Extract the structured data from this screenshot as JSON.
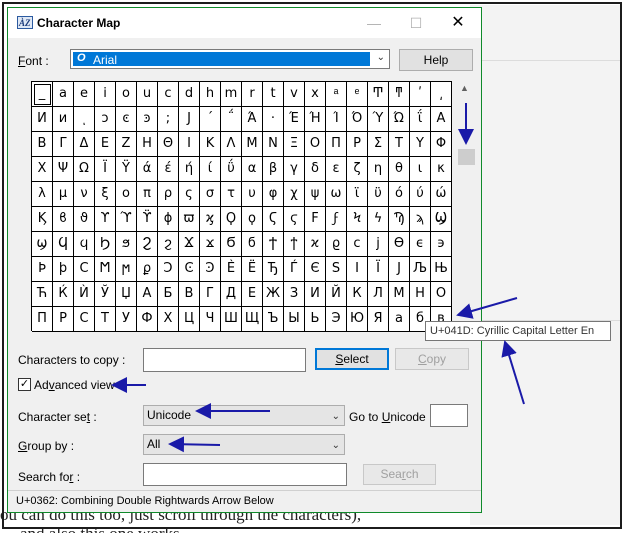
{
  "window": {
    "title": "Character Map",
    "icon_name": "character-map-app-icon",
    "minimize_label": "—",
    "maximize_label": "☐",
    "close_label": "✕"
  },
  "font_row": {
    "label_ul": "F",
    "label_rest": "ont :",
    "selected_font": "Arial",
    "help_label": "Help"
  },
  "char_grid": {
    "rows": [
      [
        "_",
        "a",
        "e",
        "i",
        "o",
        "u",
        "c",
        "d",
        "h",
        "m",
        "r",
        "t",
        "v",
        "x",
        "ͣ",
        "ͤ",
        "Ͳ",
        "ͳ",
        "ʹ",
        "͵"
      ],
      [
        "Ͷ",
        "ͷ",
        "ͺ",
        "ͻ",
        "ͼ",
        "ͽ",
        ";",
        "Ϳ",
        "΄",
        "΅",
        "Ά",
        "·",
        "Έ",
        "Ή",
        "Ί",
        "Ό",
        "Ύ",
        "Ώ",
        "ΐ",
        "Α"
      ],
      [
        "Β",
        "Γ",
        "Δ",
        "Ε",
        "Ζ",
        "Η",
        "Θ",
        "Ι",
        "Κ",
        "Λ",
        "Μ",
        "Ν",
        "Ξ",
        "Ο",
        "Π",
        "Ρ",
        "Σ",
        "Τ",
        "Υ",
        "Φ"
      ],
      [
        "Χ",
        "Ψ",
        "Ω",
        "Ϊ",
        "Ϋ",
        "ά",
        "έ",
        "ή",
        "ί",
        "ΰ",
        "α",
        "β",
        "γ",
        "δ",
        "ε",
        "ζ",
        "η",
        "θ",
        "ι",
        "κ"
      ],
      [
        "λ",
        "μ",
        "ν",
        "ξ",
        "ο",
        "π",
        "ρ",
        "ς",
        "σ",
        "τ",
        "υ",
        "φ",
        "χ",
        "ψ",
        "ω",
        "ϊ",
        "ϋ",
        "ό",
        "ύ",
        "ώ"
      ],
      [
        "Ϗ",
        "ϐ",
        "ϑ",
        "ϒ",
        "ϓ",
        "ϔ",
        "ϕ",
        "ϖ",
        "ϗ",
        "Ϙ",
        "ϙ",
        "Ϛ",
        "ϛ",
        "Ϝ",
        "ϝ",
        "Ϟ",
        "ϟ",
        "Ϡ",
        "ϡ",
        "Ϣ"
      ],
      [
        "ϣ",
        "Ϥ",
        "ϥ",
        "Ϧ",
        "ϧ",
        "Ϩ",
        "ϩ",
        "Ϫ",
        "ϫ",
        "Ϭ",
        "ϭ",
        "Ϯ",
        "ϯ",
        "ϰ",
        "ϱ",
        "ϲ",
        "ϳ",
        "ϴ",
        "ϵ",
        "϶"
      ],
      [
        "Ϸ",
        "ϸ",
        "Ϲ",
        "Ϻ",
        "ϻ",
        "ϼ",
        "Ͻ",
        "Ͼ",
        "Ͽ",
        "Ѐ",
        "Ё",
        "Ђ",
        "Ѓ",
        "Є",
        "Ѕ",
        "І",
        "Ї",
        "Ј",
        "Љ",
        "Њ"
      ],
      [
        "Ћ",
        "Ќ",
        "Ѝ",
        "Ў",
        "Џ",
        "А",
        "Б",
        "В",
        "Г",
        "Д",
        "Е",
        "Ж",
        "З",
        "И",
        "Й",
        "К",
        "Л",
        "М",
        "Н",
        "О"
      ],
      [
        "П",
        "Р",
        "С",
        "Т",
        "У",
        "Ф",
        "Х",
        "Ц",
        "Ч",
        "Ш",
        "Щ",
        "Ъ",
        "Ы",
        "Ь",
        "Э",
        "Ю",
        "Я",
        "а",
        "б",
        "в"
      ]
    ],
    "tooltip": "U+041D: Cyrillic Capital Letter En"
  },
  "copy_row": {
    "label_pre": "Characters to copy :",
    "value": "",
    "select_ul": "S",
    "select_rest": "elect",
    "copy_ul": "C",
    "copy_rest": "opy"
  },
  "advanced": {
    "ul": "v",
    "label_pre": "Ad",
    "label_post": "anced view",
    "checked_mark": "✓"
  },
  "charset": {
    "label_pre": "Character se",
    "label_ul": "t",
    "label_post": " :",
    "value": "Unicode",
    "goto_pre": "Go to ",
    "goto_ul": "U",
    "goto_post": "nicode :",
    "goto_value": ""
  },
  "groupby": {
    "label_ul": "G",
    "label_post": "roup by :",
    "value": "All"
  },
  "search": {
    "label_pre": "Search fo",
    "label_ul": "r",
    "label_post": " :",
    "value": "",
    "button_pre": "Sea",
    "button_ul": "r",
    "button_post": "ch"
  },
  "status": {
    "text": "U+0362: Combining Double Rightwards Arrow Below"
  },
  "background": {
    "line1": "ou can do this too, just scroll through the characters),",
    "line2": "and also this one works"
  },
  "annotation_color": "#1a1aa8"
}
